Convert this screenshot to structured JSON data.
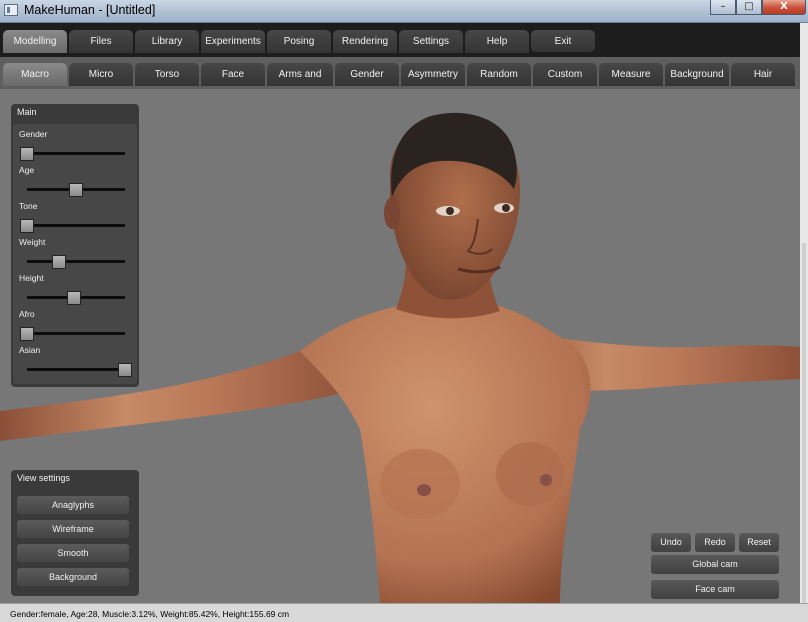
{
  "window": {
    "title": "MakeHuman - [Untitled]",
    "minimize": "–",
    "maximize": "□",
    "close": "X"
  },
  "menu": {
    "tabs": [
      {
        "label": "Modelling"
      },
      {
        "label": "Files"
      },
      {
        "label": "Library"
      },
      {
        "label": "Experiments"
      },
      {
        "label": "Posing"
      },
      {
        "label": "Rendering"
      },
      {
        "label": "Settings"
      },
      {
        "label": "Help"
      },
      {
        "label": "Exit"
      }
    ],
    "active": "Modelling"
  },
  "subtabs": {
    "tabs": [
      {
        "label": "Macro"
      },
      {
        "label": "Micro"
      },
      {
        "label": "Torso"
      },
      {
        "label": "Face"
      },
      {
        "label": "Arms and Legs"
      },
      {
        "label": "Gender"
      },
      {
        "label": "Asymmetry"
      },
      {
        "label": "Random"
      },
      {
        "label": "Custom"
      },
      {
        "label": "Measure"
      },
      {
        "label": "Background"
      },
      {
        "label": "Hair"
      }
    ],
    "active": "Macro"
  },
  "main_panel": {
    "title": "Main",
    "sliders": [
      {
        "label": "Gender",
        "value": 0.0
      },
      {
        "label": "Age",
        "value": 0.5
      },
      {
        "label": "Tone",
        "value": 0.0
      },
      {
        "label": "Weight",
        "value": 0.33
      },
      {
        "label": "Height",
        "value": 0.48
      },
      {
        "label": "Afro",
        "value": 0.0
      },
      {
        "label": "Asian",
        "value": 1.0
      }
    ]
  },
  "view_settings": {
    "title": "View settings",
    "buttons": [
      {
        "label": "Anaglyphs"
      },
      {
        "label": "Wireframe"
      },
      {
        "label": "Smooth"
      },
      {
        "label": "Background"
      }
    ]
  },
  "camera": {
    "undo": "Undo",
    "redo": "Redo",
    "reset": "Reset",
    "global_cam": "Global cam",
    "face_cam": "Face cam"
  },
  "status": {
    "text": "Gender:female, Age:28, Muscle:3.12%, Weight:85.42%, Height:155.69 cm"
  },
  "colors": {
    "skin": "#b97858",
    "skin_shadow": "#7a4532",
    "hair": "#2a2320",
    "viewport_bg": "#777777",
    "panel": "#3a3a3a"
  }
}
